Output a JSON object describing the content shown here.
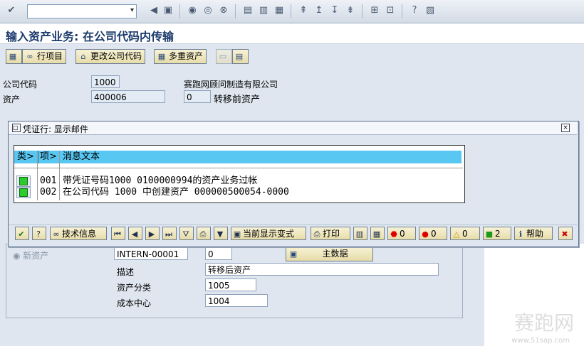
{
  "title": "输入资产业务: 在公司代码内传输",
  "app_toolbar": {
    "line_items": "行项目",
    "change_company_code": "更改公司代码",
    "multiple_assets": "多重资产"
  },
  "header": {
    "company_code_label": "公司代码",
    "company_code_value": "1000",
    "company_name": "赛跑网顾问制造有限公司",
    "asset_label": "资产",
    "asset_value": "400006",
    "sub_number": "0",
    "asset_desc": "转移前资产"
  },
  "popup": {
    "title": "凭证行: 显示邮件",
    "col_type": "类",
    "col_item": "项",
    "col_text": "消息文本",
    "messages": [
      {
        "item": "001",
        "text": "带凭证号码1000 0100000994的资产业务过帐",
        "status": "green"
      },
      {
        "item": "002",
        "text": "在公司代码 1000 中创建资产 000000500054-0000",
        "status": "green"
      }
    ],
    "toolbar": {
      "tech_info": "技术信息",
      "current_layout": "当前显示变式",
      "print": "打印",
      "stop_count": "0",
      "error_count": "0",
      "warning_count": "0",
      "success_count": "2",
      "help": "帮助"
    }
  },
  "lower": {
    "new_asset_label": "新资产",
    "new_asset_value": "INTERN-00001",
    "new_sub_number": "0",
    "master_data_btn": "主数据",
    "desc_label": "描述",
    "desc_value": "转移后资产",
    "asset_class_label": "资产分类",
    "asset_class_value": "1005",
    "cost_center_label": "成本中心",
    "cost_center_value": "1004"
  },
  "watermark": "赛跑网",
  "watermark_url": "www.51sap.com",
  "colors": {
    "header_blue": "#58c7f2",
    "title": "#1b3a6b",
    "success": "#2dcc2d"
  }
}
